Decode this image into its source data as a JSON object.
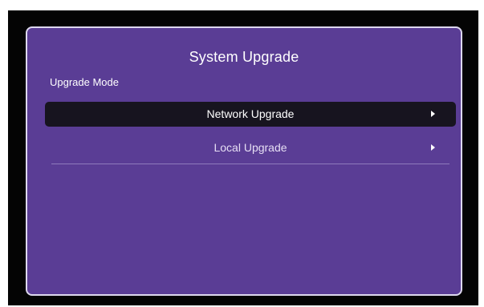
{
  "dialog": {
    "title": "System Upgrade",
    "section_label": "Upgrade Mode",
    "items": [
      {
        "label": "Network Upgrade",
        "selected": true,
        "icon": "chevron-right-icon"
      },
      {
        "label": "Local Upgrade",
        "selected": false,
        "icon": "chevron-right-icon"
      }
    ]
  },
  "colors": {
    "panel_background": "#5a3d95",
    "panel_border": "#ddd8ee",
    "selected_item_background": "#17141f",
    "screen_background": "#040404"
  }
}
